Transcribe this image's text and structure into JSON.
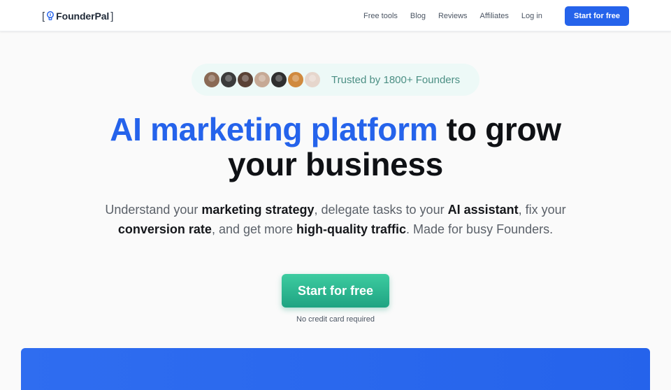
{
  "header": {
    "logo": {
      "open_bracket": "[",
      "name": "FounderPal",
      "close_bracket": "]",
      "icon": "lightbulb-icon"
    },
    "nav": [
      {
        "label": "Free tools"
      },
      {
        "label": "Blog"
      },
      {
        "label": "Reviews"
      },
      {
        "label": "Affiliates"
      },
      {
        "label": "Log in"
      }
    ],
    "cta_label": "Start for free"
  },
  "trust": {
    "text": "Trusted by 1800+ Founders",
    "avatars": [
      {
        "name": "founder-avatar-1",
        "color": "#8a6a55"
      },
      {
        "name": "founder-avatar-2",
        "color": "#3b3b3b"
      },
      {
        "name": "founder-avatar-3",
        "color": "#5a4236"
      },
      {
        "name": "founder-avatar-4",
        "color": "#c6a995"
      },
      {
        "name": "founder-avatar-5",
        "color": "#2f2f2f"
      },
      {
        "name": "founder-avatar-6",
        "color": "#d08a3e"
      },
      {
        "name": "founder-avatar-7",
        "color": "#e6d6cc"
      }
    ]
  },
  "hero": {
    "headline_accent": "AI marketing platform",
    "headline_rest_1": "to grow",
    "headline_rest_2": "your business",
    "sub": {
      "t1": "Understand your ",
      "b1": "marketing strategy",
      "t2": ", delegate tasks to your ",
      "b2": "AI assistant",
      "t3": ", fix your",
      "b3": "conversion rate",
      "t4": ", and get more ",
      "b4": "high-quality traffic",
      "t5": ". Made for busy Founders."
    },
    "cta_label": "Start for free",
    "cta_note": "No credit card required"
  },
  "colors": {
    "brand_blue": "#2563eb",
    "cta_green": "#28b48e",
    "trust_bg": "#edf9f7",
    "trust_text": "#4c8f84"
  }
}
